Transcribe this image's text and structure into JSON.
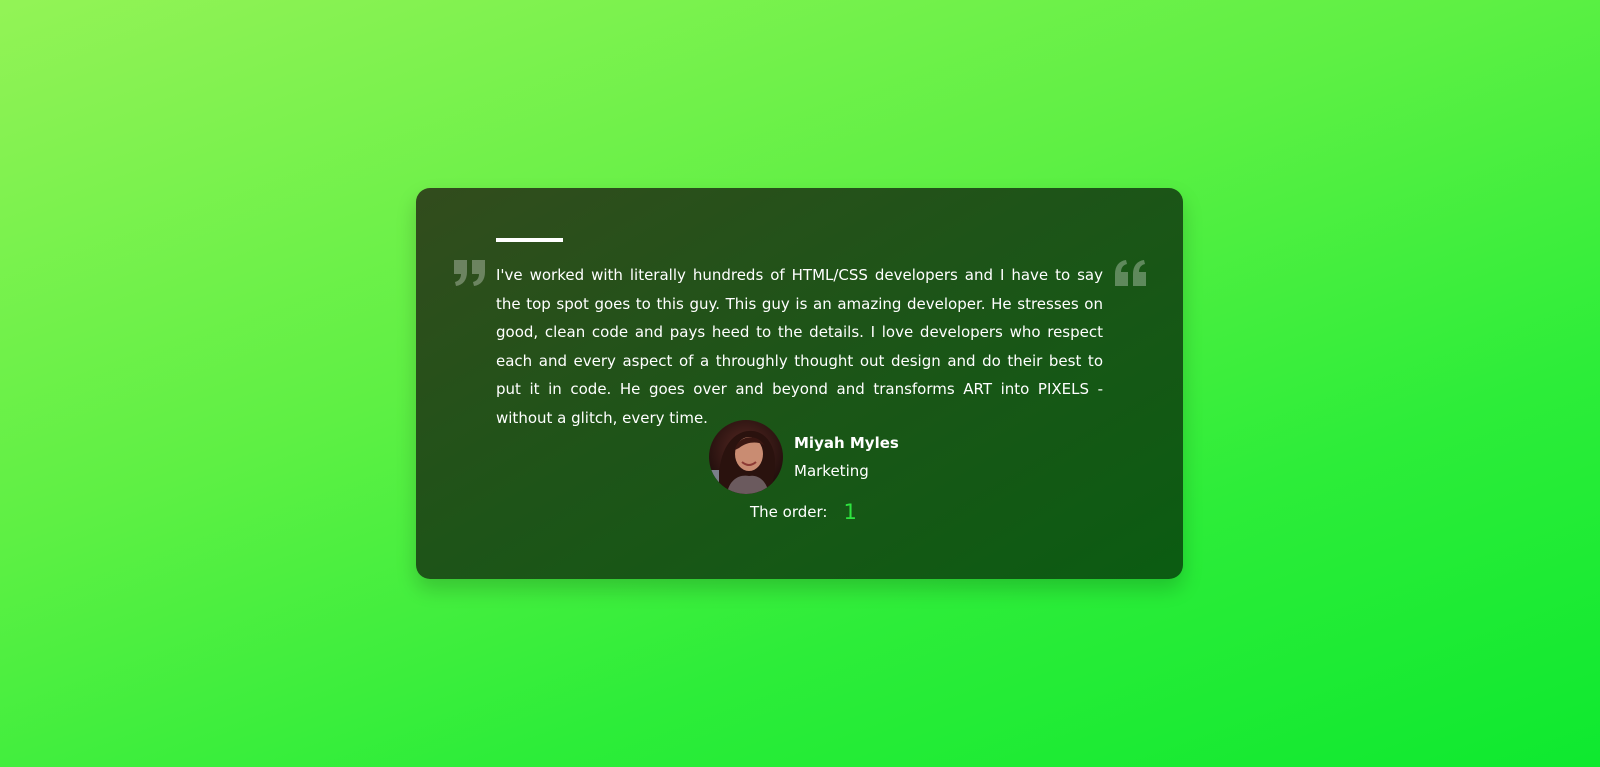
{
  "testimonial": {
    "text": "I've worked with literally hundreds of HTML/CSS developers and I have to say the top spot goes to this guy. This guy is an amazing developer. He stresses on good, clean code and pays heed to the details. I love developers who respect each and every aspect of a throughly thought out design and do their best to put it in code. He goes over and beyond and transforms ART into PIXELS - without a glitch, every time.",
    "quote_left_icon": "quote-close-icon",
    "quote_right_icon": "quote-open-icon"
  },
  "user": {
    "name": "Miyah Myles",
    "role": "Marketing",
    "avatar": "avatar-photo"
  },
  "order": {
    "label": "The order:",
    "value": "1"
  },
  "colors": {
    "accent": "#2ee43f",
    "card_start": "#324c1d",
    "card_end": "#0b5c12",
    "background_start": "#93f356",
    "background_end": "#0ee92f"
  }
}
